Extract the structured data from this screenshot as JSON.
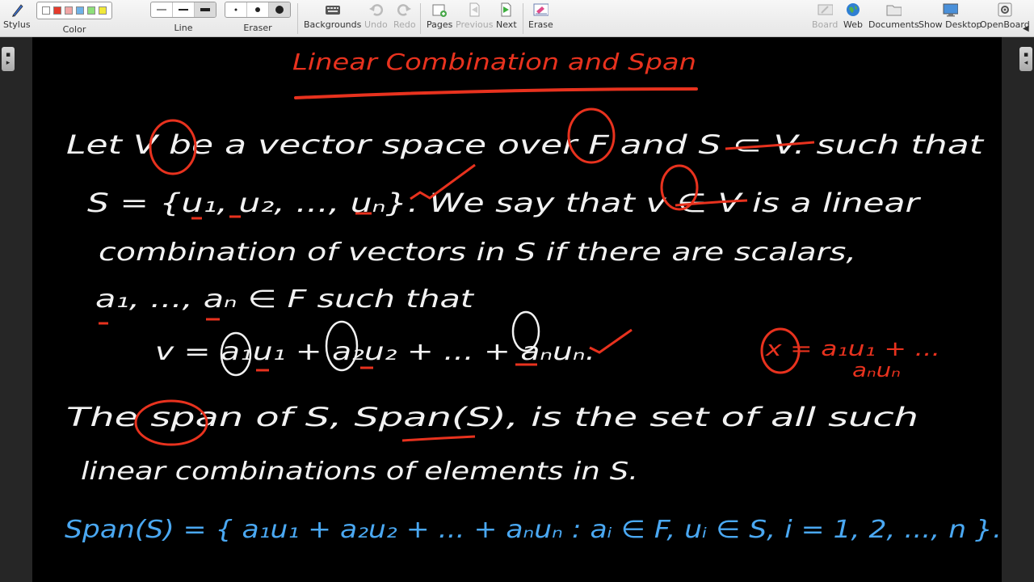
{
  "toolbar": {
    "stylus": "Stylus",
    "color": "Color",
    "line": "Line",
    "eraser": "Eraser",
    "backgrounds": "Backgrounds",
    "undo": "Undo",
    "redo": "Redo",
    "pages": "Pages",
    "previous": "Previous",
    "next": "Next",
    "erase": "Erase",
    "board": "Board",
    "web": "Web",
    "documents": "Documents",
    "show_desktop": "Show Desktop",
    "openboard": "OpenBoard",
    "palette_colors": [
      "#ffffff",
      "#e53b2c",
      "#f0a6a6",
      "#6fb2e8",
      "#8ee07a",
      "#f1e93a"
    ]
  },
  "board": {
    "title": "Linear Combination and Span",
    "white_lines": [
      "Let V be a vector space over F and S ⊂ V. such that",
      "S = {u₁, u₂, ..., uₙ}. We say that v ∈ V is a linear",
      "combination of vectors in S if there are scalars,",
      "a₁, ..., aₙ ∈ F such that",
      "v = a₁u₁ + a₂u₂ + ... + aₙuₙ.",
      "The span of S, Span(S), is the set of all such",
      "linear combinations of elements in S."
    ],
    "side_note_1": "x = a₁u₁ + ...",
    "side_note_2": "aₙuₙ",
    "span_definition": "Span(S) = { a₁u₁ + a₂u₂ + ... + aₙuₙ :  aᵢ ∈ F,  uᵢ ∈ S,  i = 1, 2, ..., n }.",
    "ink_colors": {
      "white": "#f2f2f2",
      "red": "#e8321e",
      "blue": "#4aa8f2"
    }
  }
}
